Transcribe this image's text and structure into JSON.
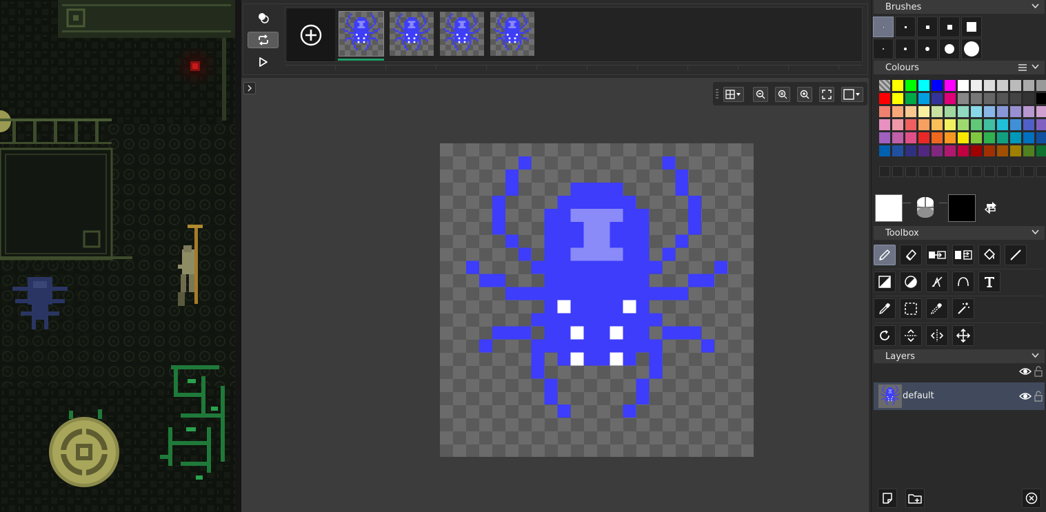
{
  "timeline": {
    "frames": [
      {
        "id": "frame-1",
        "current": true
      },
      {
        "id": "frame-2",
        "current": false
      },
      {
        "id": "frame-3",
        "current": false
      },
      {
        "id": "frame-4",
        "current": false
      }
    ]
  },
  "panels": {
    "brushes": {
      "title": "Brushes"
    },
    "colours": {
      "title": "Colours"
    },
    "toolbox": {
      "title": "Toolbox"
    },
    "layers": {
      "title": "Layers"
    }
  },
  "palette": {
    "rows": [
      [
        "#ffffff",
        "#ffff00",
        "#00ff00",
        "#00ffff",
        "#0000ff",
        "#ff00ff",
        "#ffffff",
        "#eeeeee",
        "#dddddd",
        "#cccccc",
        "#bbbbbb",
        "#aaaaaa",
        "#999999"
      ],
      [
        "#ff0000",
        "#ffff00",
        "#00aa44",
        "#00a0e0",
        "#333399",
        "#e0007a",
        "#888888",
        "#777777",
        "#666666",
        "#555555",
        "#444444",
        "#333333",
        "#000000"
      ],
      [
        "#f08070",
        "#f8a878",
        "#f8c890",
        "#f8f0a0",
        "#c8e0a0",
        "#a0d8a0",
        "#90d8c0",
        "#88d8e8",
        "#88b8e8",
        "#8898d8",
        "#9890d0",
        "#b898d0",
        "#d0a0d0"
      ],
      [
        "#e890c0",
        "#f098a8",
        "#f06060",
        "#f8a060",
        "#f8c058",
        "#f0f060",
        "#a0d870",
        "#60c878",
        "#40c0a0",
        "#20c0d8",
        "#4090d8",
        "#5060c8",
        "#8060c0"
      ],
      [
        "#a060c0",
        "#c060a8",
        "#e05088",
        "#e82828",
        "#f06820",
        "#f89820",
        "#f8e800",
        "#80c840",
        "#30b050",
        "#10a080",
        "#0098b8",
        "#0070c0",
        "#1050a0"
      ],
      [
        "#0060b0",
        "#2050a0",
        "#303080",
        "#502880",
        "#802880",
        "#b01870",
        "#c00040",
        "#a00000",
        "#a03000",
        "#a05000",
        "#a08000",
        "#508020",
        "#107030"
      ]
    ],
    "empty_slots": 13
  },
  "colours": {
    "primary": "#ffffff",
    "secondary": "#000000"
  },
  "tools": [
    {
      "name": "pencil-tool",
      "icon": "pencil-icon",
      "selected": true
    },
    {
      "name": "eraser-tool",
      "icon": "eraser-icon"
    },
    {
      "name": "replace-tool",
      "icon": "replace-colour-icon"
    },
    {
      "name": "replace-global-tool",
      "icon": "replace-all-icon"
    },
    {
      "name": "bucket-tool",
      "icon": "bucket-icon"
    },
    {
      "name": "line-tool",
      "icon": "line-icon"
    },
    {
      "name": "lighten-tool",
      "icon": "lighten-icon"
    },
    {
      "name": "darken-tool",
      "icon": "darken-icon"
    },
    {
      "name": "shading-tool",
      "icon": "shading-icon"
    },
    {
      "name": "curve-tool",
      "icon": "curve-icon"
    },
    {
      "name": "text-tool",
      "icon": "text-icon"
    },
    {
      "name": "colour-picker-tool",
      "icon": "eyedropper-icon"
    },
    {
      "name": "rect-select-tool",
      "icon": "rect-select-icon"
    },
    {
      "name": "colour-select-tool",
      "icon": "colour-select-icon"
    },
    {
      "name": "magic-wand-tool",
      "icon": "magic-wand-icon"
    },
    {
      "name": "rotate-tool",
      "icon": "rotate-icon"
    },
    {
      "name": "flip-vertical-tool",
      "icon": "flip-vertical-icon"
    },
    {
      "name": "flip-horizontal-tool",
      "icon": "flip-horizontal-icon"
    },
    {
      "name": "move-tool",
      "icon": "move-icon"
    }
  ],
  "layers": [
    {
      "name": "default",
      "visible": true,
      "locked": false
    }
  ]
}
